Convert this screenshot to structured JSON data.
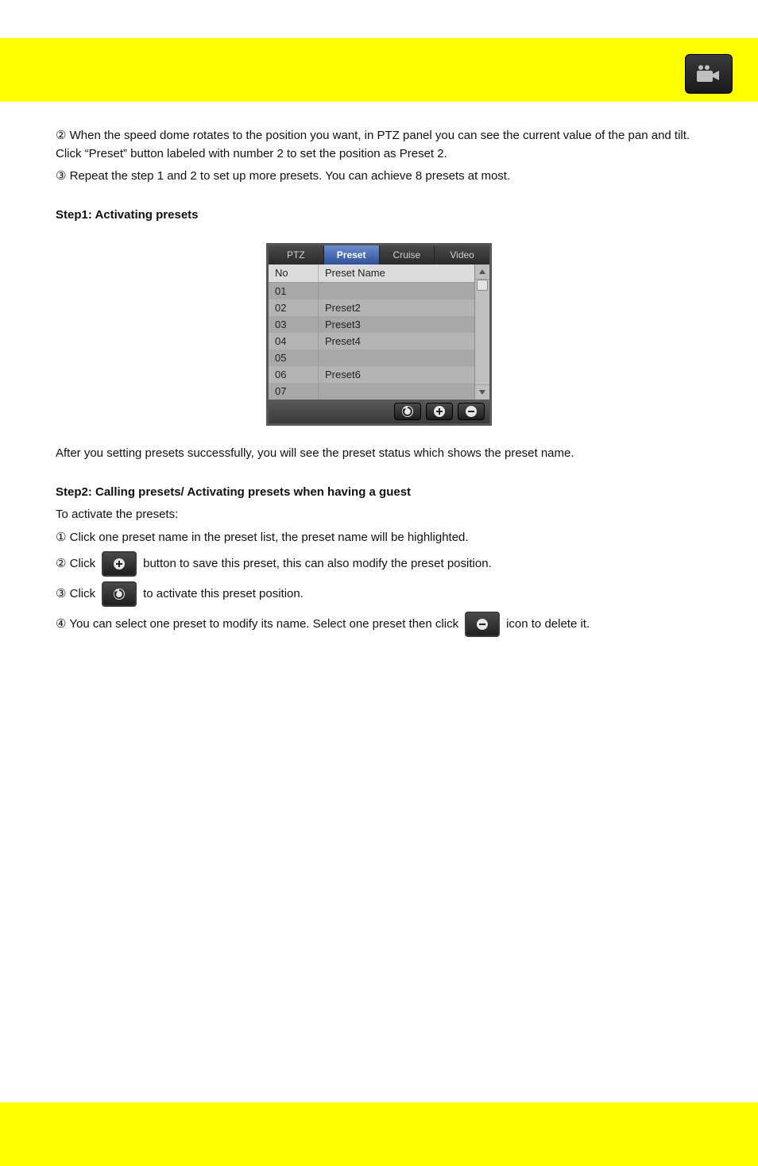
{
  "header": {
    "icon": "camera-icon"
  },
  "intro": [
    "② When the speed dome rotates to the position you want, in PTZ panel you can see the current value of the pan and tilt. Click “Preset” button labeled with number 2 to set the position as Preset 2.",
    "③ Repeat the step 1 and 2 to set up more presets. You can achieve 8 presets at most."
  ],
  "step1": "Step1: Activating presets",
  "after_ui": "After you setting presets successfully, you will see the preset status which shows the preset name.",
  "step2": "Step2: Calling presets/ Activating presets when having a guest",
  "activate_intro": "To activate the presets:",
  "activate_steps": [
    "① Click one preset name in the preset list, the preset name will be highlighted.",
    "② Click      button to save this preset, this can also modify the preset position.",
    "③ Click      to activate this preset position."
  ],
  "delete_line_pre": "④ You can select one preset to modify its name. Select one preset then click",
  "delete_line_post": "icon to delete it.",
  "ui": {
    "tabs": [
      "PTZ",
      "Preset",
      "Cruise",
      "Video"
    ],
    "active_tab": 1,
    "col_no": "No",
    "col_name": "Preset Name",
    "rows": [
      {
        "no": "01",
        "name": ""
      },
      {
        "no": "02",
        "name": "Preset2"
      },
      {
        "no": "03",
        "name": "Preset3"
      },
      {
        "no": "04",
        "name": "Preset4"
      },
      {
        "no": "05",
        "name": ""
      },
      {
        "no": "06",
        "name": "Preset6"
      },
      {
        "no": "07",
        "name": ""
      }
    ]
  }
}
